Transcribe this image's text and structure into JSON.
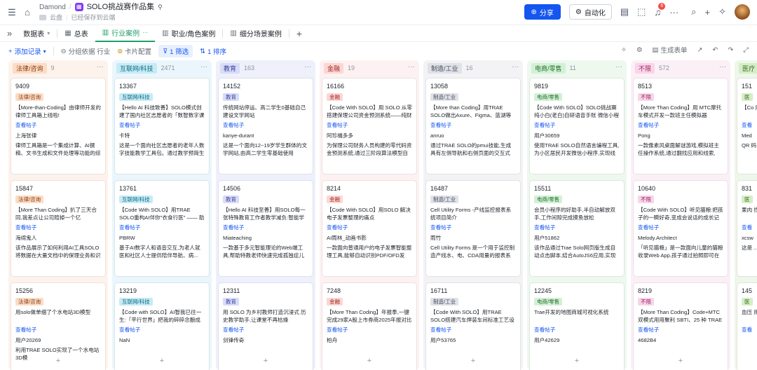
{
  "breadcrumb": {
    "workspace": "Damond",
    "app_title": "SOLO挑战赛作品集",
    "location": "云盘",
    "save_status": "已经保存到云端"
  },
  "header": {
    "share_label": "分享",
    "automation_label": "自动化",
    "notif_count": "6"
  },
  "tabs": [
    {
      "label": "数据表"
    },
    {
      "label": "总表"
    },
    {
      "label": "行业案例"
    },
    {
      "label": "职业/角色案例"
    },
    {
      "label": "细分场景案例"
    }
  ],
  "toolbar": {
    "add_record": "添加记录",
    "group_by": "分组依据 行业",
    "card_config": "卡片配置",
    "filter": "1 筛选",
    "sort": "1 排序",
    "generate_form": "生成表单"
  },
  "colors": {
    "primary": "#1456f0",
    "active_tab": "#22a06b"
  },
  "columns": [
    {
      "name": "法律/咨询",
      "count": "9",
      "bg": "#fdf3ec",
      "tag_bg": "#fbdcc6",
      "tag_fg": "#8a3e0f",
      "cards": [
        {
          "id": "9409",
          "tag": "法律/咨询",
          "title": "【More-than-Coding】由律师开发的律师工具箱上线啦!",
          "link": "查看帖子",
          "author": "上海张律",
          "desc": "律师工具箱是一个集成计算、AI撰稿、文书生成和文件处理等功能的综合性..."
        },
        {
          "id": "15847",
          "tag": "法律/咨询",
          "title": "【More Than Coding】扒了三天合同,我差点让公司赔掉一个亿",
          "link": "查看帖子",
          "author": "海绵鬼人",
          "desc": "该作品展示了如何利用AI工具SOLO将数据在大量文档中的保理业务和识别与..."
        },
        {
          "id": "15256",
          "tag": "法律/咨询",
          "title": "用solo做单细了个水电站3D模型",
          "link": "查看帖子",
          "author": "用户20269",
          "desc": "利用TRAE SOLO实现了一个水电站3D模"
        }
      ]
    },
    {
      "name": "互联网/科技",
      "count": "2471",
      "bg": "#eaf6fb",
      "tag_bg": "#c7ebf5",
      "tag_fg": "#0b6a84",
      "cards": [
        {
          "id": "13367",
          "tag": "互联网/科技",
          "title": "【Hello AI 科技致善】SOLO模式创建了国内社区志愿者的「数智数字课堂」...",
          "link": "查看帖子",
          "author": "卡特",
          "desc": "这是一个面向社区志愿者的老年人数字技能教学工具包。通过教学预简生成..."
        },
        {
          "id": "13761",
          "tag": "互联网/科技",
          "title": "【Code With SOLO】用TRAE SOLO重构AI伴你\"衣食行医\" —— 助力老人就医...",
          "link": "查看帖子",
          "author": "PBRW",
          "desc": "基于AI数字人和语音交互,为老人就医和社区人士提供陪伴导航、病..."
        },
        {
          "id": "13219",
          "tag": "互联网/科技",
          "title": "【Code with SOLO】AI智我已往一生:「平行世界」把我的碎碎念酿成了治...",
          "link": "查看帖子",
          "author": "NaN",
          "desc": ""
        }
      ]
    },
    {
      "name": "教育",
      "count": "163",
      "bg": "#eef0fb",
      "tag_bg": "#d8dcf7",
      "tag_fg": "#3b46a0",
      "cards": [
        {
          "id": "14152",
          "tag": "教育",
          "title": "传统网站停运、高二学生0基础自己建设文学网站",
          "link": "查看帖子",
          "author": "kanye-durant",
          "desc": "这是一个面向12~19岁学生群体的文学网站,由高二学生零基础使用TRAE..."
        },
        {
          "id": "14506",
          "tag": "教育",
          "title": "【Hello AI 科技至善】用SOLO每一张特殊教育工作者教学减负:智能学情分...",
          "link": "查看帖子",
          "author": "Miateaching",
          "desc": "一款基于多元智能理论的Web端工具,帮助特教老师快速完成孤独症儿童学..."
        },
        {
          "id": "12311",
          "tag": "教育",
          "title": "用 SOLO 为乡村教师打造沉浸式 历史教学助手,让课堂不再枯燥",
          "link": "查看帖子",
          "author": "剑锋传奇",
          "desc": ""
        }
      ]
    },
    {
      "name": "金融",
      "count": "19",
      "bg": "#fdf1f1",
      "tag_bg": "#fad7d5",
      "tag_fg": "#a3281f",
      "cards": [
        {
          "id": "16166",
          "tag": "金融",
          "title": "【Code With SOLO】用 SOLO 从零搭建保理公司资金预测系统——纯财务人...",
          "link": "查看帖子",
          "author": "阿珍福多多",
          "desc": "为保理公司财务人员构建的零代码资金预测系统,通过三阶段算法模型自动分..."
        },
        {
          "id": "8214",
          "tag": "金融",
          "title": "【Code With SOLO】用SOLO 解决电子发票整理的痛点",
          "link": "查看帖子",
          "author": "AI雨林_动画书影",
          "desc": "一款面向普通用户的电子发票智能整理工具,能够自动识别PDF/OFD发票..."
        },
        {
          "id": "7248",
          "tag": "金融",
          "title": "【More Than Coding】年报季,一键完成29家A股上市券商2025年报对比分析",
          "link": "查看帖子",
          "author": "柏舟",
          "desc": ""
        }
      ]
    },
    {
      "name": "制造/工业",
      "count": "16",
      "bg": "#f3f3f6",
      "tag_bg": "#e0e2e8",
      "tag_fg": "#44495a",
      "cards": [
        {
          "id": "13058",
          "tag": "制造/工业",
          "title": "【More than Coding】用TRAE SOLO做出Axure、Figma、蓝湖等专业原型效...",
          "link": "查看帖子",
          "author": "anruo",
          "desc": "通过TRAE SOLO的pmui技能,生成具有左侧导航和右侧页面的交互式产..."
        },
        {
          "id": "16487",
          "tag": "制造/工业",
          "title": "Cell Utility Forms -产线监控报表系统项目简介",
          "link": "查看帖子",
          "author": "雨竹",
          "desc": "Cell Utility Forms 是一个用于监控制造产线水、电、CDA用量的报表系统,..."
        },
        {
          "id": "16711",
          "tag": "制造/工业",
          "title": "【Code With SOLO】用TRAE SOLO搭建汽车焊装车间标准工艺设备管理系统...",
          "link": "查看帖子",
          "author": "用户53765",
          "desc": ""
        }
      ]
    },
    {
      "name": "电商/零售",
      "count": "11",
      "bg": "#eef8ef",
      "tag_bg": "#d3f0d6",
      "tag_fg": "#23702d",
      "cards": [
        {
          "id": "9819",
          "tag": "电商/零售",
          "title": "【Code With SOLO】SOLO挑战赛 纯小白(老白)自研语音手账 微信小程序",
          "link": "查看帖子",
          "author": "用户30659",
          "desc": "使用TRAE SOLO自然语言编程工具,为小区居民开发微信小程序,实现线上..."
        },
        {
          "id": "15511",
          "tag": "电商/零售",
          "title": "会员小程序的好助手,半自动解放双手,工作间隙完成摸鱼放松",
          "link": "查看帖子",
          "author": "用户51862",
          "desc": "该作品通过Trae Solo网页版生成自动点击脚本,结合AutoJS6应用,实现支付..."
        },
        {
          "id": "12245",
          "tag": "电商/零售",
          "title": "Trae开发的地图商城可视化系统",
          "link": "查看帖子",
          "author": "用户42629",
          "desc": ""
        }
      ]
    },
    {
      "name": "不限",
      "count": "572",
      "bg": "#fbf0f6",
      "tag_bg": "#f8d5e8",
      "tag_fg": "#9e2366",
      "cards": [
        {
          "id": "8513",
          "tag": "不限",
          "title": "【More Than Coding】用 MTC摩托车模式开发一款班主任模拟器",
          "link": "查看帖子",
          "author": "Pong",
          "desc": "一款像素风桌面解谜游戏,模拟班主任操作系统,通过翻找应用和线索,揭..."
        },
        {
          "id": "10640",
          "tag": "不限",
          "title": "【Code With SOLO】听见猫粮:把孩子的一瞬好奇,变成会说话的成长记录",
          "link": "查看帖子",
          "author": "Melody.Architect",
          "desc": "「听见猫粮」是一款面向儿童的猫粮收录Web App,孩子通过拍照即可在30..."
        },
        {
          "id": "8219",
          "tag": "不限",
          "title": "【More Than Coding】Code+MTC双模式用用聚利 SBTI、25 种 TRAE 社区...",
          "link": "查看帖子",
          "author": "4682B4",
          "desc": ""
        }
      ]
    },
    {
      "name": "医疗",
      "count": "",
      "bg": "#eef7e9",
      "tag_bg": "#d5eec7",
      "tag_fg": "#3c6b22",
      "cards": [
        {
          "id": "151",
          "tag": "医",
          "title": "【Co 用 S",
          "link": "查看",
          "author": "Med",
          "desc": "QR 码"
        },
        {
          "id": "831",
          "tag": "医",
          "title": "果肉 找光",
          "link": "查看",
          "author": "xcsw",
          "desc": "这是 ..."
        },
        {
          "id": "145",
          "tag": "医",
          "title": "血压 用用",
          "link": "查看",
          "author": "",
          "desc": ""
        }
      ]
    }
  ]
}
